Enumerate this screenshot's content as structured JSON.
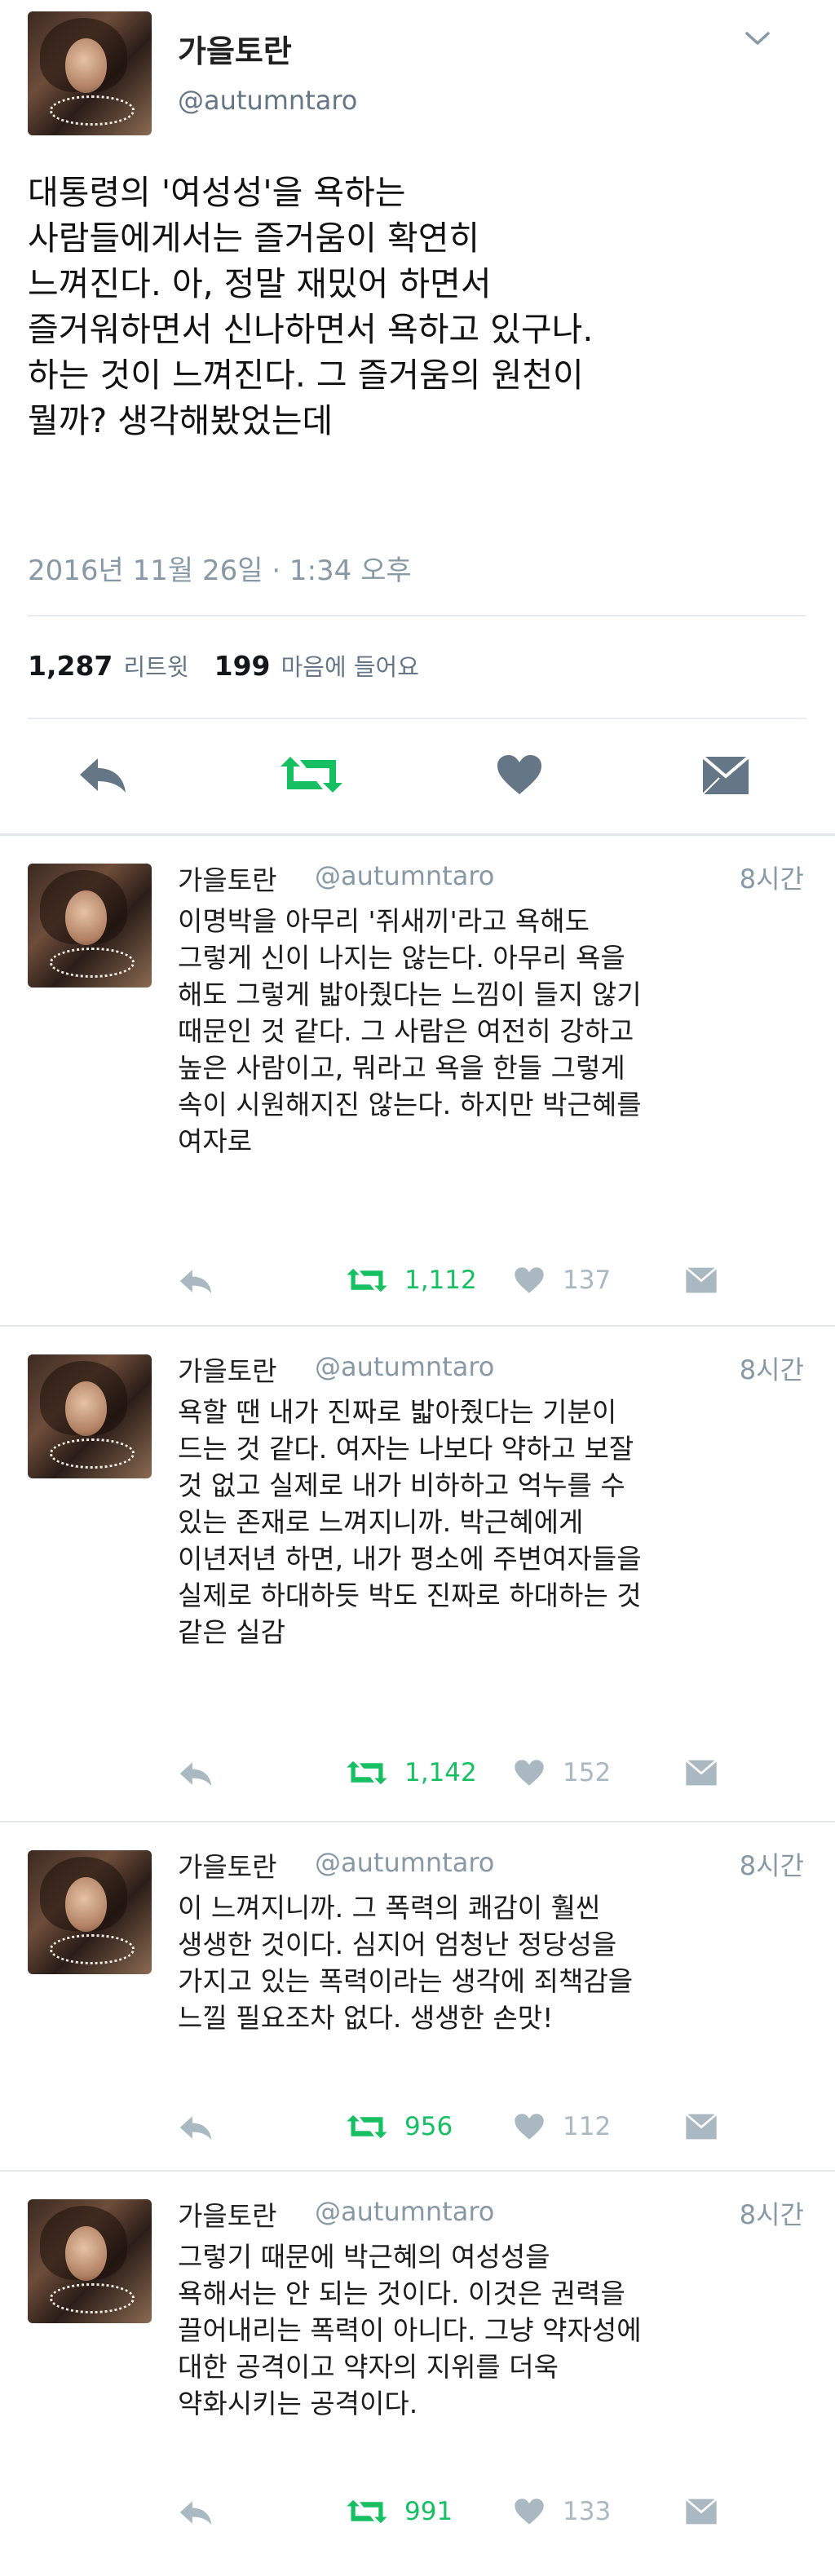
{
  "main_tweet": {
    "name": "가을토란",
    "handle": "@autumntaro",
    "text": "대통령의 '여성성'을 욕하는\n사람들에게서는 즐거움이 확연히\n느껴진다. 아, 정말 재밌어 하면서\n즐거워하면서 신나하면서 욕하고 있구나.\n하는 것이 느껴진다. 그 즐거움의 원천이\n뭘까? 생각해봤었는데",
    "timestamp": "2016년 11월 26일 · 1:34 오후",
    "retweet_count": "1,287",
    "retweet_label": "리트윗",
    "like_count": "199",
    "like_label": "마음에 들어요",
    "icons": [
      "reply-icon",
      "retweet-icon",
      "heart-icon",
      "message-icon"
    ],
    "accent_color": "#17bf63",
    "icon_color": "#657786"
  },
  "replies": [
    {
      "name": "가을토란",
      "handle": "@autumntaro",
      "time": "8시간",
      "text": "이명박을 아무리 '쥐새끼'라고 욕해도\n그렇게 신이 나지는 않는다. 아무리 욕을\n해도 그렇게 밟아줬다는 느낌이 들지 않기\n때문인 것 같다. 그 사람은 여전히 강하고\n높은 사람이고, 뭐라고 욕을 한들 그렇게\n속이 시원해지진 않는다. 하지만 박근혜를\n여자로",
      "retweets": "1,112",
      "likes": "137"
    },
    {
      "name": "가을토란",
      "handle": "@autumntaro",
      "time": "8시간",
      "text": "욕할 땐 내가 진짜로 밟아줬다는 기분이\n드는 것 같다. 여자는 나보다 약하고 보잘\n것 없고 실제로 내가 비하하고 억누를 수\n있는 존재로 느껴지니까. 박근혜에게\n이년저년 하면, 내가 평소에 주변여자들을\n실제로 하대하듯 박도 진짜로 하대하는 것\n같은 실감",
      "retweets": "1,142",
      "likes": "152"
    },
    {
      "name": "가을토란",
      "handle": "@autumntaro",
      "time": "8시간",
      "text": "이 느껴지니까. 그 폭력의 쾌감이 훨씬\n생생한 것이다. 심지어 엄청난 정당성을\n가지고 있는 폭력이라는 생각에 죄책감을\n느낄 필요조차 없다. 생생한 손맛!",
      "retweets": "956",
      "likes": "112"
    },
    {
      "name": "가을토란",
      "handle": "@autumntaro",
      "time": "8시간",
      "text": "그렇기 때문에 박근혜의 여성성을\n욕해서는 안 되는 것이다. 이것은 권력을\n끌어내리는 폭력이 아니다. 그냥 약자성에\n대한 공격이고 약자의 지위를 더욱\n약화시키는 공격이다.",
      "retweets": "991",
      "likes": "133"
    }
  ]
}
